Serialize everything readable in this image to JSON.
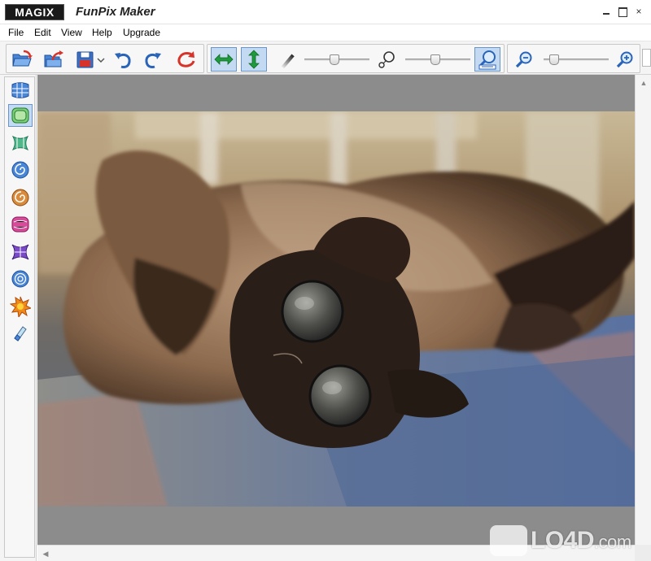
{
  "window": {
    "brand": "MAGIX",
    "title": "FunPix Maker",
    "controls": {
      "minimize": "minimize-icon",
      "maximize": "maximize-icon",
      "close": "×"
    }
  },
  "menu": [
    "File",
    "Edit",
    "View",
    "Help",
    "Upgrade"
  ],
  "toolbar": {
    "file_buttons": [
      "open-folder-icon",
      "export-icon",
      "save-icon",
      "undo-icon",
      "redo-icon",
      "reset-icon"
    ],
    "mode_buttons": [
      "horizontal-arrows-icon",
      "vertical-arrows-icon"
    ],
    "active_modes": [
      "horizontal-arrows-icon",
      "vertical-arrows-icon",
      "zoom-tool-icon"
    ],
    "brush_size_level": 0.45,
    "intensity_level": 0.45,
    "zoom_level": 0.1
  },
  "effects": [
    {
      "name": "grid-distort-icon",
      "active": false
    },
    {
      "name": "bulge-effect-icon",
      "active": true
    },
    {
      "name": "pinch-effect-icon",
      "active": false
    },
    {
      "name": "swirl-effect-icon",
      "active": false
    },
    {
      "name": "twirl-effect-icon",
      "active": false
    },
    {
      "name": "pillow-effect-icon",
      "active": false
    },
    {
      "name": "squeeze-effect-icon",
      "active": false
    },
    {
      "name": "ripple-effect-icon",
      "active": false
    },
    {
      "name": "explode-effect-icon",
      "active": false
    },
    {
      "name": "eraser-icon",
      "active": false
    }
  ],
  "colors": {
    "accent": "#c4daf2",
    "accent_border": "#6c95c4",
    "icon_blue": "#2a64b8",
    "icon_green": "#1f9a3c",
    "icon_red": "#d6342a",
    "canvas_bg": "#8c8c8c"
  },
  "watermark": {
    "text": "LO4D",
    "suffix": ".com"
  }
}
